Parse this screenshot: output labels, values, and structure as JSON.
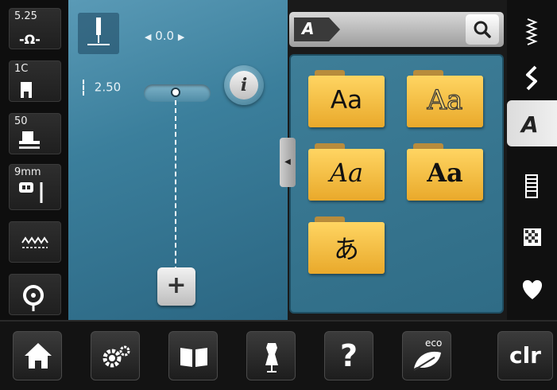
{
  "status_column": {
    "stitch_count": "5.25",
    "thread_tension": "1C",
    "presser_pressure": "50",
    "needle_size": "9mm"
  },
  "stitch_settings": {
    "width_value": "0.0",
    "length_value": "2.50"
  },
  "alphabet_panel": {
    "tab_label": "A",
    "fonts": [
      {
        "sample": "Aa",
        "icon": "block-font-folder"
      },
      {
        "sample": "Aa",
        "icon": "outline-font-folder"
      },
      {
        "sample": "Aa",
        "icon": "script-font-folder"
      },
      {
        "sample": "Aa",
        "icon": "gothic-font-folder"
      },
      {
        "sample": "あ",
        "icon": "japanese-font-folder"
      }
    ]
  },
  "right_tabs": [
    {
      "icon": "practical-stitch-icon"
    },
    {
      "icon": "decorative-stitch-icon"
    },
    {
      "icon": "alphabet-icon",
      "label": "A",
      "active": true
    },
    {
      "icon": "buttonhole-icon"
    },
    {
      "icon": "quilt-stitch-icon"
    },
    {
      "icon": "personal-program-icon"
    }
  ],
  "bottom_bar": {
    "eco_label": "eco",
    "clear_label": "clr",
    "help_label": "?"
  },
  "colors": {
    "main_blue": "#3b7f9c",
    "folder_yellow": "#f5c84a",
    "accent_dark": "#1a1a1a"
  }
}
